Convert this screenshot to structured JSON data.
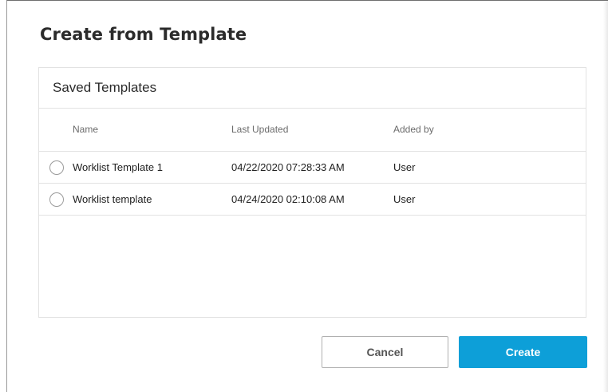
{
  "dialog": {
    "title": "Create from Template"
  },
  "panel": {
    "title": "Saved Templates"
  },
  "table": {
    "columns": [
      "Name",
      "Last Updated",
      "Added by"
    ],
    "rows": [
      {
        "name": "Worklist Template 1",
        "last_updated": "04/22/2020 07:28:33 AM",
        "added_by": "User",
        "selected": false
      },
      {
        "name": "Worklist template",
        "last_updated": "04/24/2020 02:10:08 AM",
        "added_by": "User",
        "selected": false
      }
    ]
  },
  "buttons": {
    "cancel_label": "Cancel",
    "create_label": "Create"
  },
  "colors": {
    "primary": "#0d9fd8",
    "border": "#e2e2e2"
  }
}
